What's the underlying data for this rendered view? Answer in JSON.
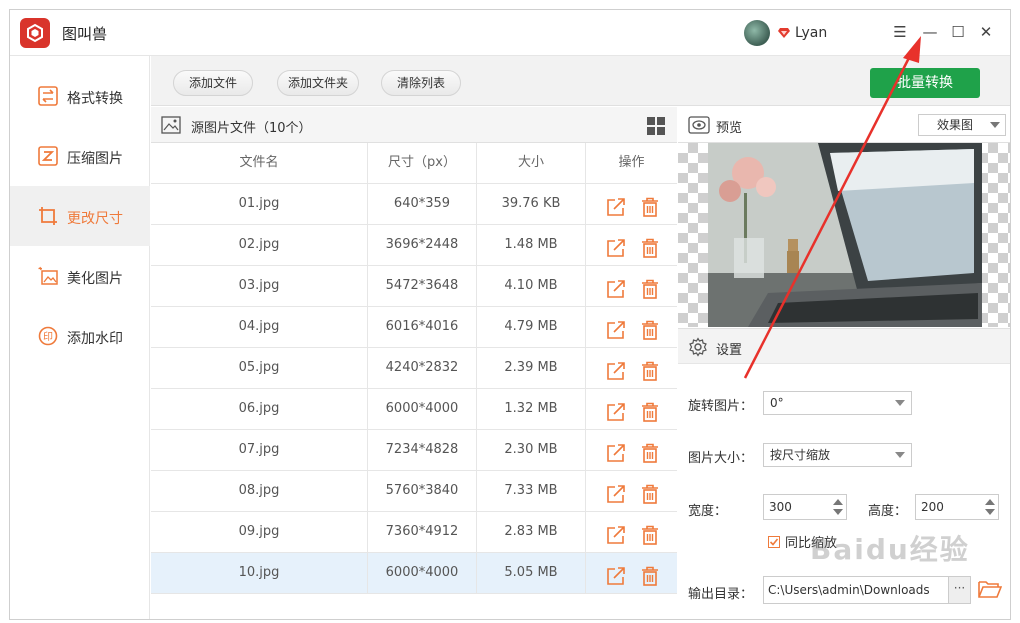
{
  "app": {
    "title": "图叫兽",
    "username": "Lyan"
  },
  "window_controls": {
    "menu": "☰",
    "minimize": "—",
    "maximize": "☐",
    "close": "✕"
  },
  "sidebar": {
    "items": [
      {
        "label": "格式转换",
        "icon": "swap-icon"
      },
      {
        "label": "压缩图片",
        "icon": "compress-icon"
      },
      {
        "label": "更改尺寸",
        "icon": "resize-icon"
      },
      {
        "label": "美化图片",
        "icon": "beautify-icon"
      },
      {
        "label": "添加水印",
        "icon": "watermark-icon"
      }
    ],
    "active_index": 2
  },
  "toolbar": {
    "add_file": "添加文件",
    "add_folder": "添加文件夹",
    "clear_list": "清除列表",
    "batch_convert": "批量转换"
  },
  "file_list": {
    "title": "源图片文件（10个）",
    "columns": [
      "文件名",
      "尺寸（px）",
      "大小",
      "操作"
    ],
    "rows": [
      {
        "name": "01.jpg",
        "size": "640*359",
        "filesize": "39.76 KB"
      },
      {
        "name": "02.jpg",
        "size": "3696*2448",
        "filesize": "1.48 MB"
      },
      {
        "name": "03.jpg",
        "size": "5472*3648",
        "filesize": "4.10 MB"
      },
      {
        "name": "04.jpg",
        "size": "6016*4016",
        "filesize": "4.79 MB"
      },
      {
        "name": "05.jpg",
        "size": "4240*2832",
        "filesize": "2.39 MB"
      },
      {
        "name": "06.jpg",
        "size": "6000*4000",
        "filesize": "1.32 MB"
      },
      {
        "name": "07.jpg",
        "size": "7234*4828",
        "filesize": "2.30 MB"
      },
      {
        "name": "08.jpg",
        "size": "5760*3840",
        "filesize": "7.33 MB"
      },
      {
        "name": "09.jpg",
        "size": "7360*4912",
        "filesize": "2.83 MB"
      },
      {
        "name": "10.jpg",
        "size": "6000*4000",
        "filesize": "5.05 MB"
      }
    ],
    "selected_index": 9
  },
  "preview": {
    "title": "预览",
    "mode": "效果图"
  },
  "settings": {
    "title": "设置",
    "rotate_label": "旋转图片：",
    "rotate_value": "0°",
    "size_label": "图片大小：",
    "size_value": "按尺寸缩放",
    "width_label": "宽度：",
    "width_value": "300",
    "height_label": "高度：",
    "height_value": "200",
    "keep_ratio_label": "同比缩放",
    "keep_ratio_checked": true,
    "output_label": "输出目录：",
    "output_value": "C:\\Users\\admin\\Downloads",
    "output_more": "···"
  },
  "watermark_text": "Baidu经验",
  "colors": {
    "accent": "#ef7a3b",
    "primary_button": "#1fa24a",
    "annotation": "#e8312b",
    "selected_row": "#e6f1fb"
  }
}
